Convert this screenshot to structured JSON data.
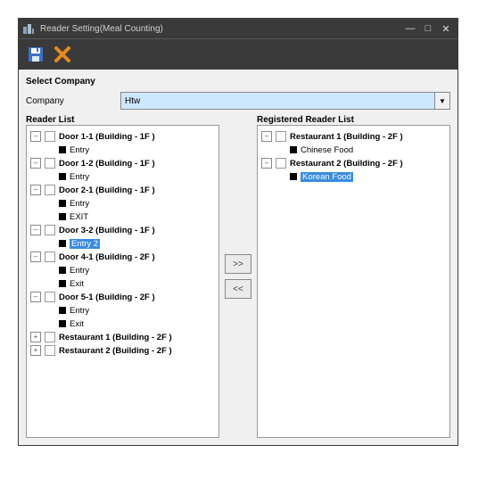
{
  "window": {
    "title": "Reader Setting(Meal Counting)"
  },
  "toolbar": {
    "save_label": "Save",
    "close_label": "Close"
  },
  "company": {
    "section_label": "Select Company",
    "field_label": "Company",
    "value": "Htw"
  },
  "buttons": {
    "add": ">>",
    "remove": "<<"
  },
  "panels": {
    "left_title": "Reader List",
    "right_title": "Registered Reader List"
  },
  "left_tree": [
    {
      "label": "Door 1-1 (Building - 1F )",
      "expanded": true,
      "type": "folder",
      "children": [
        {
          "label": "Entry",
          "type": "reader"
        }
      ]
    },
    {
      "label": "Door 1-2 (Building - 1F )",
      "expanded": true,
      "type": "folder",
      "children": [
        {
          "label": "Entry",
          "type": "reader"
        }
      ]
    },
    {
      "label": "Door 2-1 (Building - 1F )",
      "expanded": true,
      "type": "folder",
      "children": [
        {
          "label": "Entry",
          "type": "reader"
        },
        {
          "label": "EXIT",
          "type": "reader"
        }
      ]
    },
    {
      "label": "Door 3-2 (Building - 1F )",
      "expanded": true,
      "type": "folder",
      "children": [
        {
          "label": "Entry 2",
          "type": "reader",
          "selected": true
        }
      ]
    },
    {
      "label": "Door 4-1 (Building - 2F )",
      "expanded": true,
      "type": "folder",
      "children": [
        {
          "label": "Entry",
          "type": "reader"
        },
        {
          "label": "Exit",
          "type": "reader"
        }
      ]
    },
    {
      "label": "Door 5-1 (Building - 2F )",
      "expanded": true,
      "type": "folder",
      "children": [
        {
          "label": "Entry",
          "type": "reader"
        },
        {
          "label": "Exit",
          "type": "reader"
        }
      ]
    },
    {
      "label": "Restaurant 1 (Building - 2F )",
      "expanded": false,
      "type": "folder",
      "children": []
    },
    {
      "label": "Restaurant 2 (Building - 2F )",
      "expanded": false,
      "type": "folder",
      "children": []
    }
  ],
  "right_tree": [
    {
      "label": "Restaurant 1 (Building - 2F )",
      "expanded": true,
      "type": "folder",
      "children": [
        {
          "label": "Chinese Food",
          "type": "reader"
        }
      ]
    },
    {
      "label": "Restaurant 2 (Building - 2F )",
      "expanded": true,
      "type": "folder",
      "children": [
        {
          "label": "Korean Food",
          "type": "reader",
          "selected": true
        }
      ]
    }
  ]
}
